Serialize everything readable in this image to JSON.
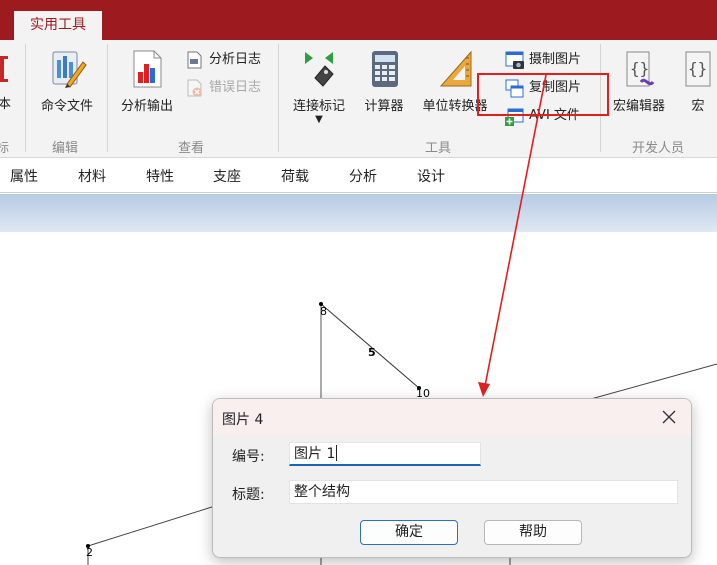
{
  "tabs": {
    "active": "实用工具"
  },
  "ribbon": {
    "partial_left_label": "文本",
    "partial_left_group": "标",
    "groups": {
      "edit": "编辑",
      "view": "查看",
      "tools": "工具",
      "developer": "开发人员"
    },
    "buttons": {
      "command_file": "命令文件",
      "analysis_output": "分析输出",
      "analysis_log": "分析日志",
      "error_log": "错误日志",
      "connection_markers": "连接标记",
      "calculator": "计算器",
      "unit_converter": "单位转换器",
      "capture_image": "摄制图片",
      "copy_image": "复制图片",
      "avi_file": "AVI 文件",
      "macro_editor": "宏编辑器",
      "macro": "宏"
    }
  },
  "menubar": [
    "属性",
    "材料",
    "特性",
    "支座",
    "荷载",
    "分析",
    "设计"
  ],
  "canvas": {
    "node_labels": [
      "8",
      "10",
      "2"
    ],
    "member_label": "5"
  },
  "dialog": {
    "title": "图片 4",
    "number_label": "编号:",
    "number_value": "图片 1",
    "caption_label": "标题:",
    "caption_value": "整个结构",
    "ok_label": "确定",
    "help_label": "帮助"
  },
  "colors": {
    "brand": "#9d1b1e",
    "highlight": "#e02020",
    "focus": "#1a63b8"
  }
}
